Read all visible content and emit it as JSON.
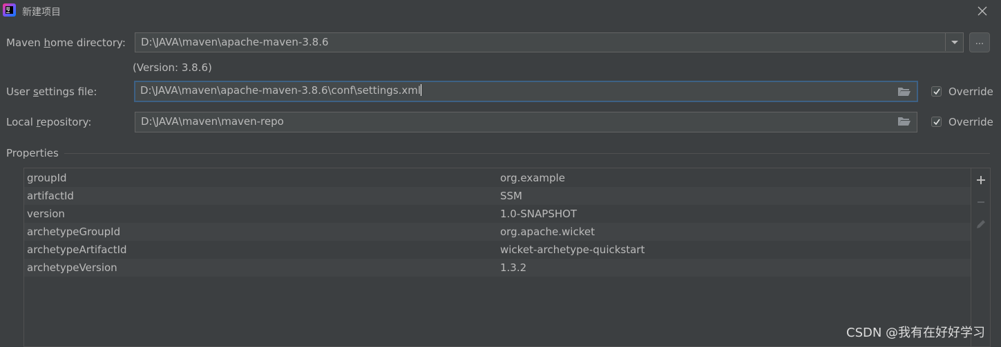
{
  "window": {
    "title": "新建项目"
  },
  "maven_home": {
    "label_pre": "Maven ",
    "label_mnemonic": "h",
    "label_post": "ome directory:",
    "value": "D:\\JAVA\\maven\\apache-maven-3.8.6",
    "browse_label": "...",
    "version_note": "(Version: 3.8.6)"
  },
  "user_settings": {
    "label_pre": "User ",
    "label_mnemonic": "s",
    "label_post": "ettings file:",
    "value": "D:\\JAVA\\maven\\apache-maven-3.8.6\\conf\\settings.xml",
    "override_label": "Override",
    "override_checked": true
  },
  "local_repo": {
    "label_pre": "Local ",
    "label_mnemonic": "r",
    "label_post": "epository:",
    "value": "D:\\JAVA\\maven\\maven-repo",
    "override_label": "Override",
    "override_checked": true
  },
  "properties": {
    "title": "Properties",
    "rows": [
      {
        "key": "groupId",
        "value": "org.example"
      },
      {
        "key": "artifactId",
        "value": "SSM"
      },
      {
        "key": "version",
        "value": "1.0-SNAPSHOT"
      },
      {
        "key": "archetypeGroupId",
        "value": "org.apache.wicket"
      },
      {
        "key": "archetypeArtifactId",
        "value": "wicket-archetype-quickstart"
      },
      {
        "key": "archetypeVersion",
        "value": "1.3.2"
      }
    ]
  },
  "watermark": "CSDN @我有在好好学习",
  "colors": {
    "background": "#3c3f41",
    "field_background": "#45494a",
    "focus_border": "#3d6185",
    "text": "#bbbbbb"
  }
}
